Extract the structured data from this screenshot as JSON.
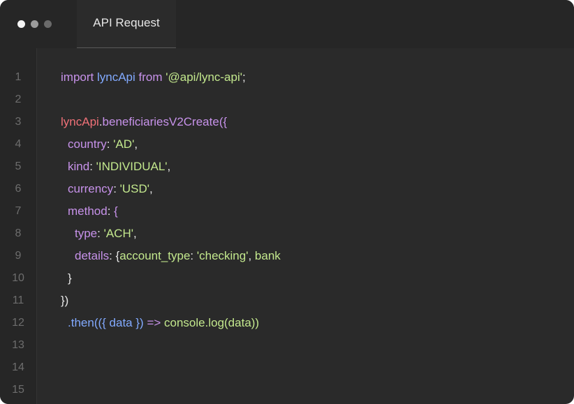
{
  "window": {
    "tab_title": "API Request",
    "traffic_lights": [
      "close-dot",
      "minimize-dot",
      "maximize-dot"
    ]
  },
  "editor": {
    "line_numbers": [
      "1",
      "2",
      "3",
      "4",
      "5",
      "6",
      "7",
      "8",
      "9",
      "10",
      "11",
      "12",
      "13",
      "14",
      "15"
    ],
    "lines": {
      "l1": {
        "kw_import": "import",
        "id": "lyncApi",
        "kw_from": "from",
        "str": "'@api/lync-api'",
        "semi": ";"
      },
      "l3": {
        "obj": "lyncApi",
        "dot": ".",
        "fn": "beneficiariesV2Create",
        "punc": "({"
      },
      "l4": {
        "prop": "country",
        "colon": ": ",
        "str": "'AD'",
        "comma": ","
      },
      "l5": {
        "prop": "kind",
        "colon": ": ",
        "str": "'INDIVIDUAL'",
        "comma": ","
      },
      "l6": {
        "prop": "currency",
        "colon": ": ",
        "str": "'USD'",
        "comma": ","
      },
      "l7": {
        "prop": "method",
        "colon": ": ",
        "punc": "{"
      },
      "l8": {
        "prop": "type",
        "colon": ": ",
        "str": "'ACH'",
        "comma": ","
      },
      "l9": {
        "prop": "details",
        "colon": ": ",
        "open": "{",
        "prop2": "account_type",
        "colon2": ": ",
        "str": "'checking'",
        "comma": ", ",
        "tail": "bank"
      },
      "l10": {
        "punc": "}"
      },
      "l11": {
        "punc": "})"
      },
      "l12": {
        "meth": ".then",
        "open": "(({ ",
        "arg": "data",
        "close": " }) ",
        "arrow": "=>",
        "body": " console.log(data))"
      }
    }
  },
  "colors": {
    "background": "#2a2a2a",
    "titlebar": "#262626",
    "keyword": "#c792ea",
    "identifier": "#82aaff",
    "string": "#c3e88d",
    "object": "#f07178",
    "line_number": "#6d6d6d"
  }
}
